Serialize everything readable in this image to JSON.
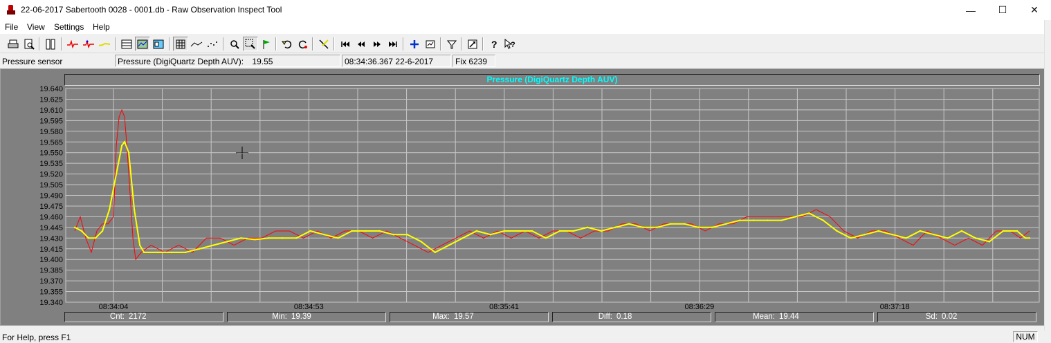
{
  "window": {
    "title": "22-06-2017 Sabertooth 0028 - 0001.db - Raw Observation Inspect Tool",
    "minimize": "—",
    "maximize": "☐",
    "close": "✕"
  },
  "menu": [
    "File",
    "View",
    "Settings",
    "Help"
  ],
  "toolbar": {
    "icons": [
      "print-icon",
      "print-preview-icon",
      "columns-icon",
      "red-line-icon",
      "red-line-marker-icon",
      "yellow-line-icon",
      "table-view-icon",
      "chart-view-icon",
      "split-view-icon",
      "grid-icon",
      "line-icon",
      "points-icon",
      "zoom-icon",
      "zoom-box-icon",
      "flag-icon",
      "undo-icon",
      "redo-icon",
      "delete-point-icon",
      "first-icon",
      "previous-icon",
      "next-icon",
      "last-icon",
      "add-icon",
      "goto-icon",
      "filter-icon",
      "export-icon",
      "help-icon",
      "context-help-icon"
    ]
  },
  "status": {
    "sensor": "Pressure sensor",
    "reading": "Pressure (DigiQuartz Depth AUV):",
    "reading_value": "19.55",
    "timestamp": "08:34:36.367 22-6-2017",
    "fix": "Fix 6239"
  },
  "chart_data": {
    "type": "line",
    "title": "Pressure (DigiQuartz Depth AUV)",
    "xlabel": "",
    "ylabel": "",
    "ylim": [
      19.34,
      19.64
    ],
    "yticks": [
      "19.640",
      "19.625",
      "19.610",
      "19.595",
      "19.580",
      "19.565",
      "19.550",
      "19.535",
      "19.520",
      "19.505",
      "19.490",
      "19.475",
      "19.460",
      "19.445",
      "19.430",
      "19.415",
      "19.400",
      "19.385",
      "19.370",
      "19.355",
      "19.340"
    ],
    "xticks": [
      "08:34:04",
      "08:34:53",
      "08:35:41",
      "08:36:29",
      "08:37:18"
    ],
    "grid": true,
    "colors": {
      "raw": "#ff0000",
      "smoothed": "#ffff00",
      "background": "#808080",
      "grid": "#c8c8c8"
    },
    "series": [
      {
        "id": "raw",
        "values": [
          [
            0,
            19.44
          ],
          [
            8,
            19.46
          ],
          [
            16,
            19.43
          ],
          [
            24,
            19.41
          ],
          [
            32,
            19.44
          ],
          [
            40,
            19.45
          ],
          [
            48,
            19.45
          ],
          [
            56,
            19.46
          ],
          [
            60,
            19.56
          ],
          [
            64,
            19.6
          ],
          [
            68,
            19.61
          ],
          [
            72,
            19.6
          ],
          [
            76,
            19.55
          ],
          [
            80,
            19.49
          ],
          [
            84,
            19.43
          ],
          [
            88,
            19.4
          ],
          [
            96,
            19.41
          ],
          [
            110,
            19.42
          ],
          [
            130,
            19.41
          ],
          [
            150,
            19.42
          ],
          [
            170,
            19.41
          ],
          [
            190,
            19.43
          ],
          [
            210,
            19.43
          ],
          [
            230,
            19.42
          ],
          [
            250,
            19.43
          ],
          [
            270,
            19.43
          ],
          [
            290,
            19.44
          ],
          [
            310,
            19.44
          ],
          [
            330,
            19.43
          ],
          [
            350,
            19.44
          ],
          [
            370,
            19.43
          ],
          [
            390,
            19.44
          ],
          [
            410,
            19.44
          ],
          [
            430,
            19.43
          ],
          [
            450,
            19.44
          ],
          [
            470,
            19.43
          ],
          [
            490,
            19.42
          ],
          [
            510,
            19.41
          ],
          [
            530,
            19.42
          ],
          [
            550,
            19.43
          ],
          [
            570,
            19.44
          ],
          [
            590,
            19.43
          ],
          [
            610,
            19.44
          ],
          [
            630,
            19.43
          ],
          [
            650,
            19.44
          ],
          [
            670,
            19.43
          ],
          [
            690,
            19.44
          ],
          [
            710,
            19.44
          ],
          [
            730,
            19.43
          ],
          [
            750,
            19.44
          ],
          [
            770,
            19.44
          ],
          [
            790,
            19.45
          ],
          [
            810,
            19.45
          ],
          [
            830,
            19.44
          ],
          [
            850,
            19.45
          ],
          [
            870,
            19.45
          ],
          [
            890,
            19.45
          ],
          [
            910,
            19.44
          ],
          [
            930,
            19.45
          ],
          [
            950,
            19.45
          ],
          [
            970,
            19.46
          ],
          [
            990,
            19.46
          ],
          [
            1010,
            19.46
          ],
          [
            1030,
            19.46
          ],
          [
            1050,
            19.46
          ],
          [
            1070,
            19.47
          ],
          [
            1090,
            19.46
          ],
          [
            1110,
            19.44
          ],
          [
            1130,
            19.43
          ],
          [
            1150,
            19.44
          ],
          [
            1170,
            19.44
          ],
          [
            1190,
            19.43
          ],
          [
            1210,
            19.42
          ],
          [
            1230,
            19.44
          ],
          [
            1250,
            19.43
          ],
          [
            1270,
            19.42
          ],
          [
            1290,
            19.43
          ],
          [
            1310,
            19.42
          ],
          [
            1330,
            19.44
          ],
          [
            1350,
            19.44
          ],
          [
            1365,
            19.43
          ],
          [
            1378,
            19.44
          ]
        ]
      },
      {
        "id": "smoothed",
        "values": [
          [
            0,
            19.445
          ],
          [
            10,
            19.44
          ],
          [
            20,
            19.43
          ],
          [
            30,
            19.43
          ],
          [
            40,
            19.44
          ],
          [
            50,
            19.47
          ],
          [
            60,
            19.52
          ],
          [
            68,
            19.56
          ],
          [
            72,
            19.565
          ],
          [
            78,
            19.55
          ],
          [
            86,
            19.47
          ],
          [
            94,
            19.42
          ],
          [
            100,
            19.41
          ],
          [
            120,
            19.41
          ],
          [
            140,
            19.41
          ],
          [
            160,
            19.41
          ],
          [
            180,
            19.415
          ],
          [
            200,
            19.42
          ],
          [
            220,
            19.425
          ],
          [
            240,
            19.43
          ],
          [
            260,
            19.428
          ],
          [
            280,
            19.43
          ],
          [
            300,
            19.43
          ],
          [
            320,
            19.43
          ],
          [
            340,
            19.44
          ],
          [
            360,
            19.435
          ],
          [
            380,
            19.43
          ],
          [
            400,
            19.44
          ],
          [
            420,
            19.44
          ],
          [
            440,
            19.44
          ],
          [
            460,
            19.435
          ],
          [
            480,
            19.435
          ],
          [
            500,
            19.425
          ],
          [
            520,
            19.41
          ],
          [
            540,
            19.42
          ],
          [
            560,
            19.43
          ],
          [
            580,
            19.44
          ],
          [
            600,
            19.435
          ],
          [
            620,
            19.44
          ],
          [
            640,
            19.44
          ],
          [
            660,
            19.44
          ],
          [
            680,
            19.43
          ],
          [
            700,
            19.44
          ],
          [
            720,
            19.44
          ],
          [
            740,
            19.445
          ],
          [
            760,
            19.44
          ],
          [
            780,
            19.445
          ],
          [
            800,
            19.45
          ],
          [
            820,
            19.445
          ],
          [
            840,
            19.445
          ],
          [
            860,
            19.45
          ],
          [
            880,
            19.45
          ],
          [
            900,
            19.445
          ],
          [
            920,
            19.445
          ],
          [
            940,
            19.45
          ],
          [
            960,
            19.455
          ],
          [
            980,
            19.455
          ],
          [
            1000,
            19.455
          ],
          [
            1020,
            19.455
          ],
          [
            1040,
            19.46
          ],
          [
            1060,
            19.465
          ],
          [
            1080,
            19.455
          ],
          [
            1100,
            19.44
          ],
          [
            1120,
            19.43
          ],
          [
            1140,
            19.435
          ],
          [
            1160,
            19.44
          ],
          [
            1180,
            19.435
          ],
          [
            1200,
            19.43
          ],
          [
            1220,
            19.44
          ],
          [
            1240,
            19.435
          ],
          [
            1260,
            19.43
          ],
          [
            1280,
            19.44
          ],
          [
            1300,
            19.43
          ],
          [
            1320,
            19.425
          ],
          [
            1340,
            19.44
          ],
          [
            1360,
            19.44
          ],
          [
            1372,
            19.43
          ],
          [
            1378,
            19.43
          ]
        ]
      }
    ]
  },
  "stats": {
    "cnt_label": "Cnt:",
    "cnt_value": "2172",
    "min_label": "Min:",
    "min_value": "19.39",
    "max_label": "Max:",
    "max_value": "19.57",
    "diff_label": "Diff:",
    "diff_value": "0.18",
    "mean_label": "Mean:",
    "mean_value": "19.44",
    "sd_label": "Sd:",
    "sd_value": "0.02"
  },
  "footer": {
    "help": "For Help, press F1",
    "num": "NUM"
  }
}
